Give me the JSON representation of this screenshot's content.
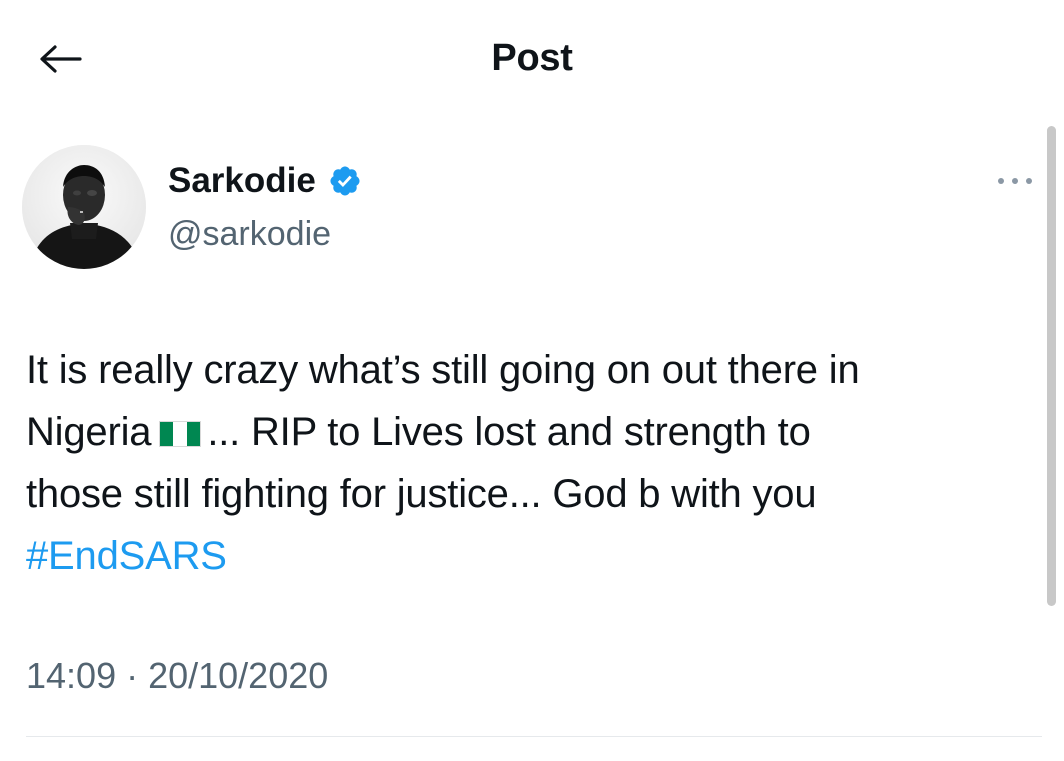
{
  "header": {
    "title": "Post",
    "back_icon": "arrow-left-icon"
  },
  "author": {
    "name": "Sarkodie",
    "handle": "@sarkodie",
    "verified": true,
    "verified_icon": "verified-badge-icon",
    "verified_color": "#1d9bf0"
  },
  "post": {
    "line1": "It is really crazy what’s still going on out there in",
    "line2_before_flag": "Nigeria",
    "flag_icon": "nigeria-flag-icon",
    "line2_after_flag": "... RIP to Lives lost and strength to",
    "line3": "those still fighting for justice...  God b with you",
    "hashtag": "#EndSARS",
    "timestamp": "14:09 · 20/10/2020"
  },
  "menu": {
    "icon": "more-options-icon"
  },
  "colors": {
    "accent": "#1d9bf0",
    "text": "#0f1419",
    "secondary_text": "#536471",
    "flag_green": "#008751"
  }
}
